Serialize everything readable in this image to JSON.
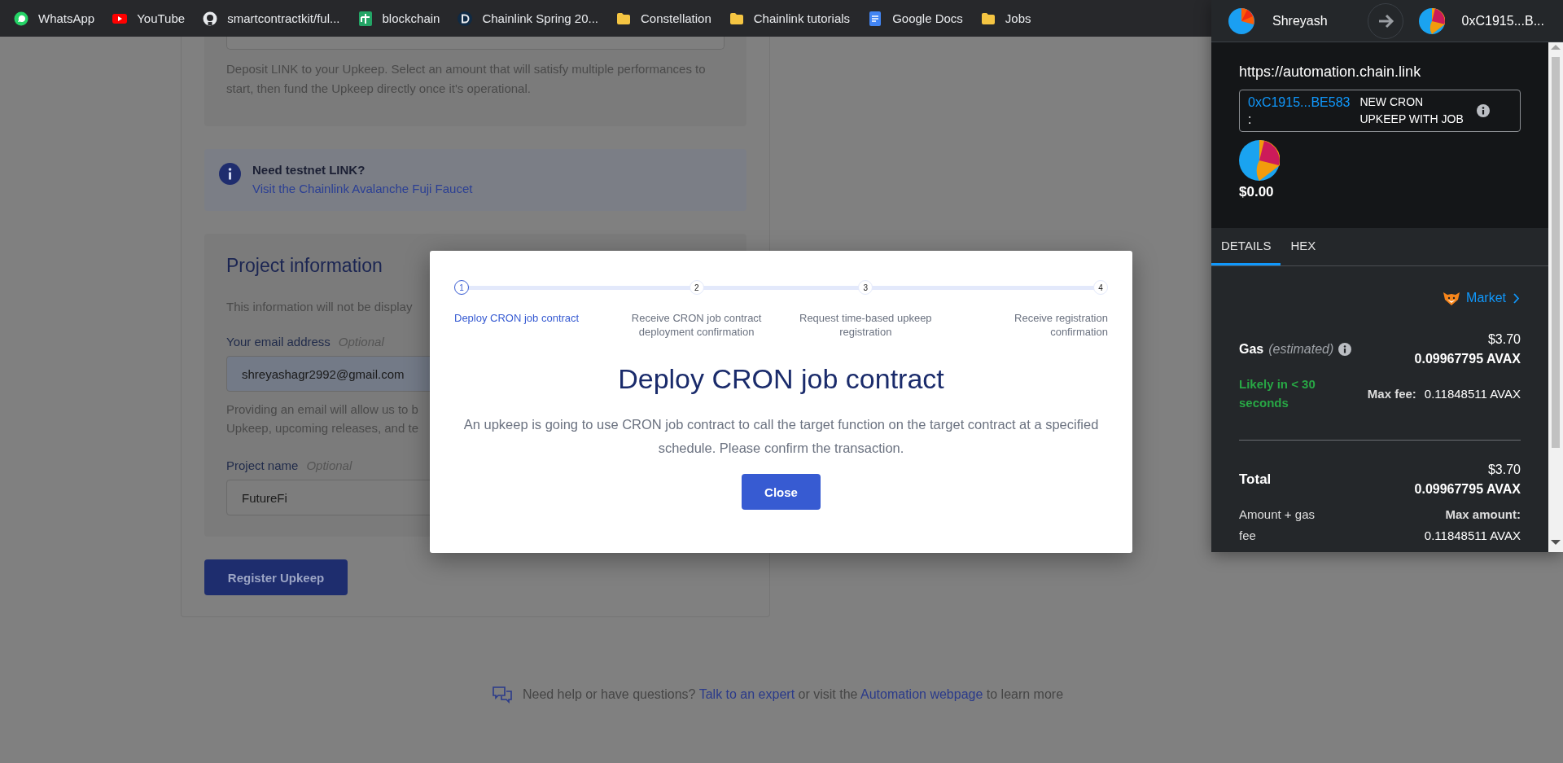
{
  "bookmarks": [
    {
      "label": "WhatsApp"
    },
    {
      "label": "YouTube"
    },
    {
      "label": "smartcontractkit/ful..."
    },
    {
      "label": "blockchain"
    },
    {
      "label": "Chainlink Spring 20..."
    },
    {
      "label": "Constellation"
    },
    {
      "label": "Chainlink tutorials"
    },
    {
      "label": "Google Docs"
    },
    {
      "label": "Jobs"
    }
  ],
  "form": {
    "deposit_hint": "Deposit LINK to your Upkeep. Select an amount that will satisfy multiple performances to start, then fund the Upkeep directly once it's operational.",
    "info": {
      "title": "Need testnet LINK?",
      "link": "Visit the Chainlink Avalanche Fuji Faucet"
    },
    "project": {
      "heading": "Project information",
      "description": "This information will not be display",
      "email": {
        "label": "Your email address",
        "optional": "Optional",
        "value": "shreyashagr2992@gmail.com"
      },
      "email_hint_lines": [
        "Providing an email will allow us to b",
        "Upkeep, upcoming releases, and te"
      ],
      "name": {
        "label": "Project name",
        "optional": "Optional",
        "value": "FutureFi"
      }
    },
    "register_button": "Register Upkeep"
  },
  "footer": {
    "segments": [
      {
        "kind": "text",
        "text": "Need help or have questions?"
      },
      {
        "kind": "link",
        "text": "Talk to an expert"
      },
      {
        "kind": "text",
        "text": "or visit the"
      },
      {
        "kind": "link",
        "text": "Automation webpage"
      },
      {
        "kind": "text",
        "text": "to learn more"
      }
    ]
  },
  "modal": {
    "steps": [
      {
        "number": "1",
        "label": "Deploy CRON job contract",
        "selected": true
      },
      {
        "number": "2",
        "label": "Receive CRON job contract deployment confirmation",
        "selected": false
      },
      {
        "number": "3",
        "label": "Request time-based upkeep registration",
        "selected": false
      },
      {
        "number": "4",
        "label": "Receive registration confirmation",
        "selected": false
      }
    ],
    "title": "Deploy CRON job contract",
    "body": "An upkeep is going to use CRON job contract to call the target function on the target contract at a specified schedule. Please confirm the transaction.",
    "close_button": "Close"
  },
  "wallet": {
    "from_account": "Shreyash",
    "to_account": "0xC1915...B...",
    "origin": "https://automation.chain.link",
    "contract_address": "0xC1915...BE583",
    "contract_colon": ":",
    "method": "NEW CRON UPKEEP WITH JOB",
    "balance": "$0.00",
    "tabs": [
      {
        "label": "DETAILS",
        "selected": true
      },
      {
        "label": "HEX",
        "selected": false
      }
    ],
    "market": "Market",
    "gas": {
      "label": "Gas",
      "note": "(estimated)",
      "usd": "$3.70",
      "amount": "0.09967795 AVAX",
      "likely": "Likely in < 30 seconds",
      "max_fee_label": "Max fee:",
      "max_fee": "0.11848511 AVAX"
    },
    "total": {
      "label": "Total",
      "usd": "$3.70",
      "amount": "0.09967795 AVAX",
      "sub": "Amount + gas fee",
      "max_label": "Max amount:",
      "max": "0.11848511 AVAX"
    }
  }
}
